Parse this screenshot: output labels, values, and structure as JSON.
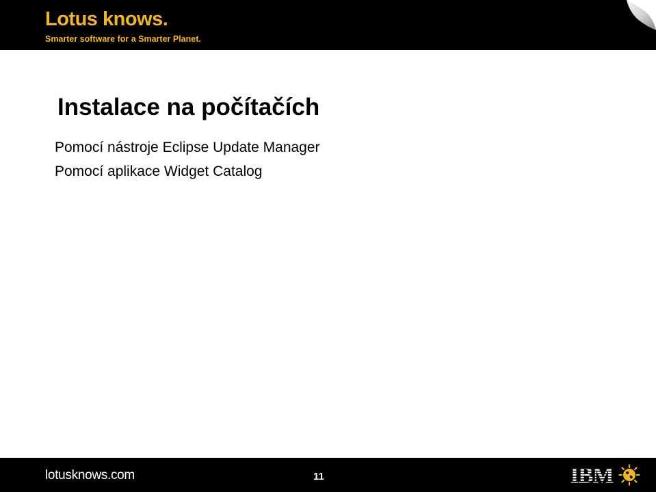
{
  "header": {
    "logo_text": "Lotus knows.",
    "tagline": "Smarter software for a Smarter Planet.",
    "brand_color": "#f0b52a",
    "corner_icon": "page-curl-icon"
  },
  "slide": {
    "title": "Instalace na počítačích",
    "bullets": [
      "Pomocí nástroje Eclipse Update Manager",
      "Pomocí aplikace Widget Catalog"
    ]
  },
  "footer": {
    "url": "lotusknows.com",
    "page_number": "11",
    "logo": "IBM",
    "planet_icon": "smarter-planet-icon"
  }
}
